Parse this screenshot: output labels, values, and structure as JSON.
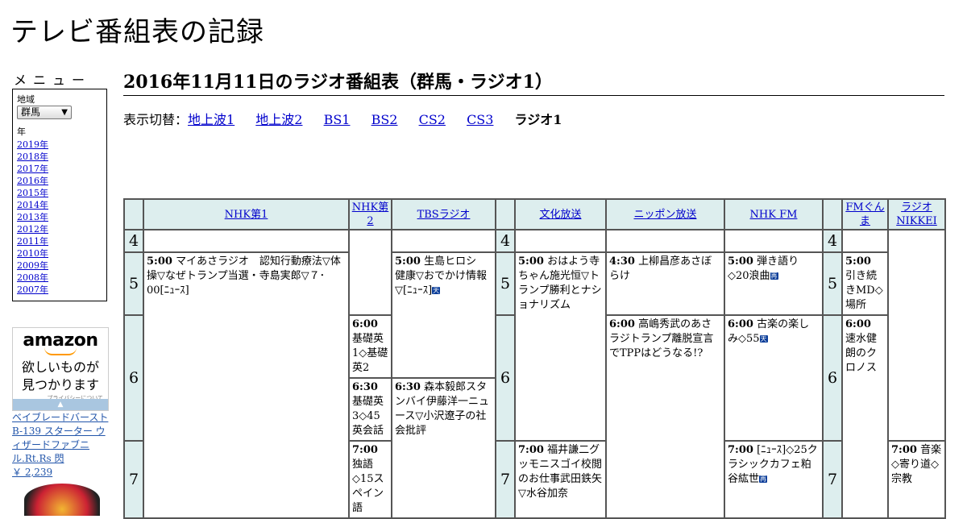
{
  "site_title": "テレビ番組表の記録",
  "menu": {
    "heading": "メニュー",
    "region_label": "地域",
    "region_value": "群馬",
    "year_label": "年",
    "years": [
      "2019年",
      "2018年",
      "2017年",
      "2016年",
      "2015年",
      "2014年",
      "2013年",
      "2012年",
      "2011年",
      "2010年",
      "2009年",
      "2008年",
      "2007年"
    ]
  },
  "ad": {
    "logo": "amazon",
    "tagline_1": "欲しいものが",
    "tagline_2": "見つかります",
    "privacy": "プライバシーについて",
    "product_name": "ベイブレードバースト B-139 スターター ウィザードファブニル.Rt.Rs 閃",
    "product_price": "￥ 2,239"
  },
  "page_title": "2016年11月11日のラジオ番組表（群馬・ラジオ1）",
  "switcher": {
    "label": "表示切替：",
    "links": [
      "地上波1",
      "地上波2",
      "BS1",
      "BS2",
      "CS2",
      "CS3"
    ],
    "current": "ラジオ1"
  },
  "colors": {
    "header_bg": "#ddeeee",
    "link": "#0000cc",
    "badge": "#0a3d99"
  },
  "schedule": {
    "stations": [
      "NHK第1",
      "NHK第2",
      "TBSラジオ",
      "文化放送",
      "ニッポン放送",
      "NHK FM",
      "FMぐんま",
      "ラジオNIKKEI"
    ],
    "hours": [
      "4",
      "5",
      "6",
      "7"
    ],
    "programs": {
      "nhk1_500": {
        "time": "5:00",
        "title": "マイあさラジオ　認知行動療法▽体操▽なぜトランプ当選・寺島実郎▽７･00[ﾆｭｰｽ]"
      },
      "tbs_500": {
        "time": "5:00",
        "title": "生島ヒロシ　健康▽おでかけ情報▽[ﾆｭｰｽ]"
      },
      "bunka_500": {
        "time": "5:00",
        "title": "おはよう寺ちゃん施光恒▽トランプ勝利とナショナリズム"
      },
      "nippon_430": {
        "time": "4:30",
        "title": "上柳昌彦あさぼらけ"
      },
      "nhkfm_500": {
        "time": "5:00",
        "title": "弾き語り◇20浪曲"
      },
      "fmgunma_500": {
        "time": "5:00",
        "title": "引き続きMD◇場所"
      },
      "nhk2_600": {
        "time": "6:00",
        "title": "基礎英1◇基礎英2"
      },
      "nippon_600": {
        "time": "6:00",
        "title": "高嶋秀武のあさラジトランプ離脱宣言でTPPはどうなる!?"
      },
      "nhkfm_600": {
        "time": "6:00",
        "title": "古楽の楽しみ◇55"
      },
      "fmgunma_600": {
        "time": "6:00",
        "title": "速水健朗のクロノス"
      },
      "nhk2_630": {
        "time": "6:30",
        "title": "基礎英3◇45英会話"
      },
      "tbs_630": {
        "time": "6:30",
        "title": "森本毅郎スタンバイ伊藤洋一ニュース▽小沢遼子の社会批評"
      },
      "nhk2_700": {
        "time": "7:00",
        "title": "独語◇15スペイン語"
      },
      "bunka_700": {
        "time": "7:00",
        "title": "福井謙二グッモニスゴイ校閲のお仕事武田鉄矢▽水谷加奈"
      },
      "nhkfm_700": {
        "time": "7:00",
        "title": "[ﾆｭｰｽ]◇25クラシックカフェ粕谷紘世"
      },
      "nikkei_700": {
        "time": "7:00",
        "title": "音楽◇寄り道◇宗教"
      }
    },
    "badges": {
      "tenki": "天",
      "sai": "再"
    }
  }
}
